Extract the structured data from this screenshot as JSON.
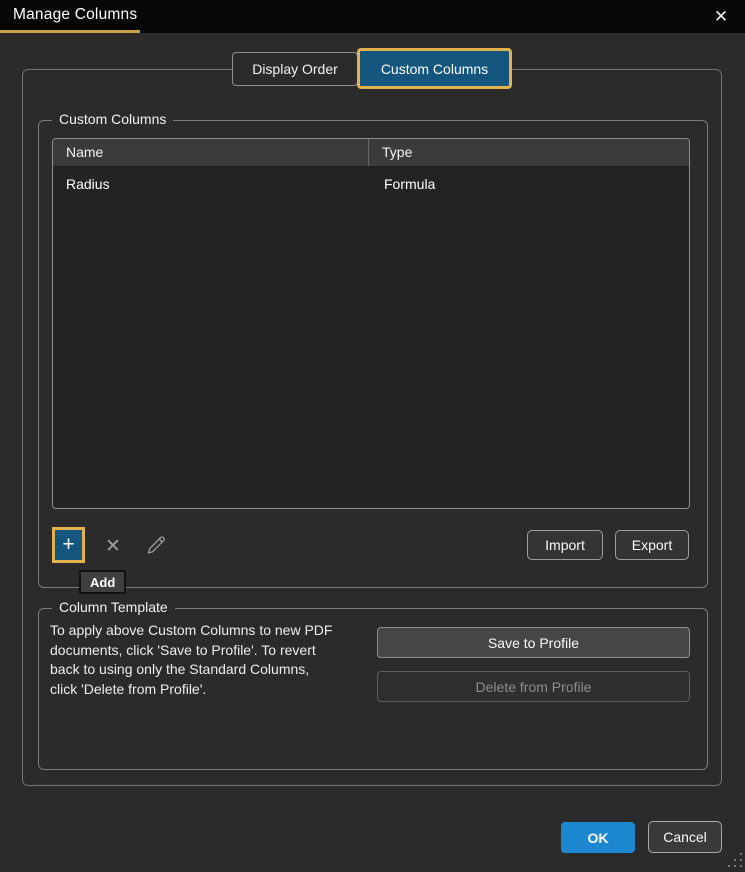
{
  "window": {
    "title": "Manage Columns",
    "close_icon": "✕"
  },
  "tabs": {
    "display_order_label": "Display Order",
    "custom_columns_label": "Custom Columns",
    "active_tab": "Custom Columns"
  },
  "custom_columns": {
    "group_label": "Custom Columns",
    "table": {
      "headers": [
        "Name",
        "Type"
      ],
      "rows": [
        {
          "name": "Radius",
          "type": "Formula"
        }
      ]
    },
    "toolbar": {
      "add_icon": "+",
      "delete_icon": "✕",
      "edit_icon": "pencil",
      "import_label": "Import",
      "export_label": "Export"
    },
    "add_tooltip": "Add"
  },
  "column_template": {
    "group_label": "Column Template",
    "description_lines": [
      "To apply above Custom Columns to new PDF",
      "documents, click 'Save to Profile'. To revert",
      "back to using only the Standard Columns,",
      "click 'Delete from Profile'."
    ],
    "save_button_label": "Save to Profile",
    "delete_button_label": "Delete from Profile",
    "delete_button_enabled": false
  },
  "footer": {
    "ok_label": "OK",
    "cancel_label": "Cancel"
  },
  "colors": {
    "accent_gold": "#e2b24e",
    "tab_active_blue": "#14567e",
    "ok_blue": "#1d87cf",
    "titlebar_bg": "#070707",
    "dialog_bg": "#2b2b2b"
  }
}
